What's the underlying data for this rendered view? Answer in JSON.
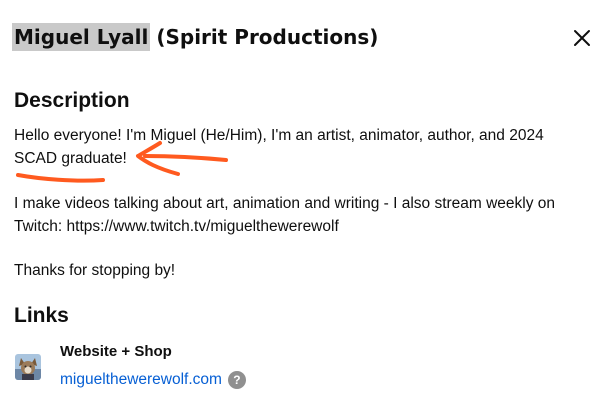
{
  "header": {
    "name": "Miguel Lyall",
    "subtitle": "(Spirit Productions)",
    "close_icon": "close-icon"
  },
  "description": {
    "heading": "Description",
    "line1": "Hello everyone! I'm Miguel (He/Him), I'm an artist, animator, author, and 2024",
    "line2": "SCAD graduate!",
    "line3": "I make videos talking about art, animation and writing - I also stream weekly on",
    "line4": "Twitch: https://www.twitch.tv/miguelthewerewolf",
    "line5": "Thanks for stopping by!"
  },
  "annotation": {
    "color": "#ff5a1f",
    "shapes": [
      "underline",
      "arrow"
    ]
  },
  "links": {
    "heading": "Links",
    "items": [
      {
        "title": "Website + Shop",
        "url": "miguelthewerewolf.com",
        "thumbnail_icon": "website-favicon-icon",
        "help_icon": "?"
      }
    ]
  },
  "colors": {
    "link": "#065fd4",
    "name_highlight": "#c9c9c9",
    "help_icon_bg": "#909090"
  }
}
